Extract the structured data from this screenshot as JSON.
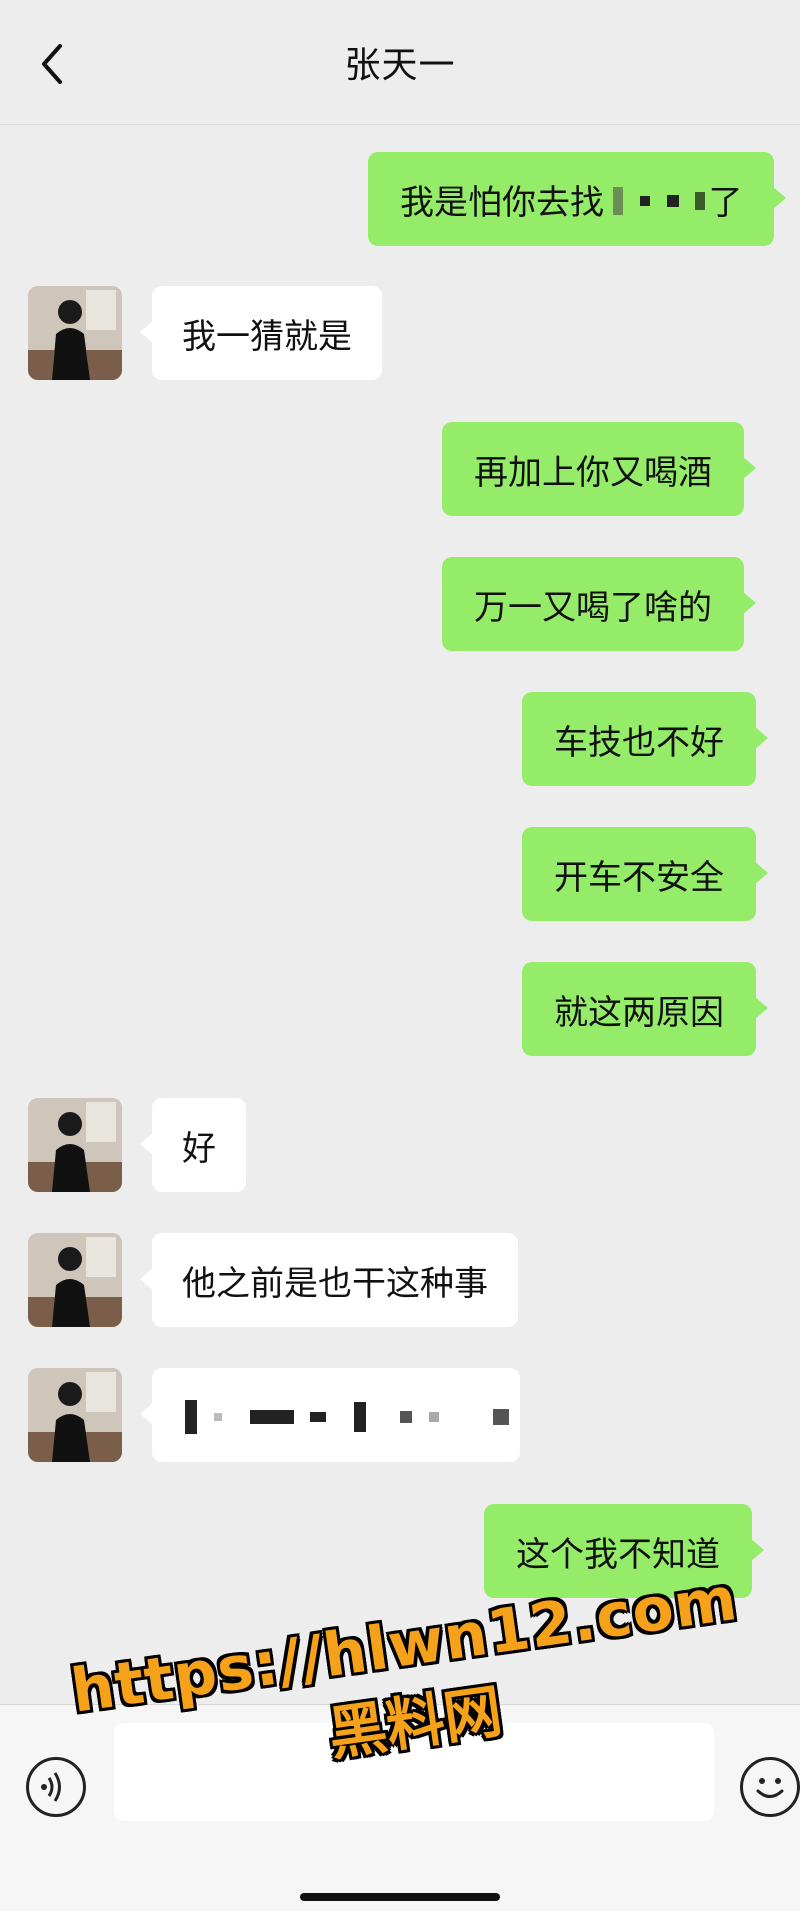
{
  "header": {
    "title": "张天一"
  },
  "messages": [
    {
      "side": "right",
      "text": "我是怕你去找",
      "suffix": "了",
      "censored": true
    },
    {
      "side": "left",
      "text": "我一猜就是"
    },
    {
      "side": "right",
      "text": "再加上你又喝酒"
    },
    {
      "side": "right",
      "text": "万一又喝了啥的"
    },
    {
      "side": "right",
      "text": "车技也不好"
    },
    {
      "side": "right",
      "text": "开车不安全"
    },
    {
      "side": "right",
      "text": "就这两原因"
    },
    {
      "side": "left",
      "text": "好"
    },
    {
      "side": "left",
      "text": "他之前是也干这种事"
    },
    {
      "side": "left",
      "text": "",
      "censored": true
    },
    {
      "side": "right",
      "text": "这个我不知道"
    }
  ],
  "input": {
    "value": ""
  },
  "watermark": {
    "url": "https://hlwn12.com",
    "name": "黑料网"
  },
  "colors": {
    "sent_bubble": "#95ec69",
    "received_bubble": "#ffffff",
    "background": "#ededed"
  },
  "icons": {
    "back": "chevron-left-icon",
    "voice": "voice-icon",
    "emoji": "emoji-icon"
  }
}
